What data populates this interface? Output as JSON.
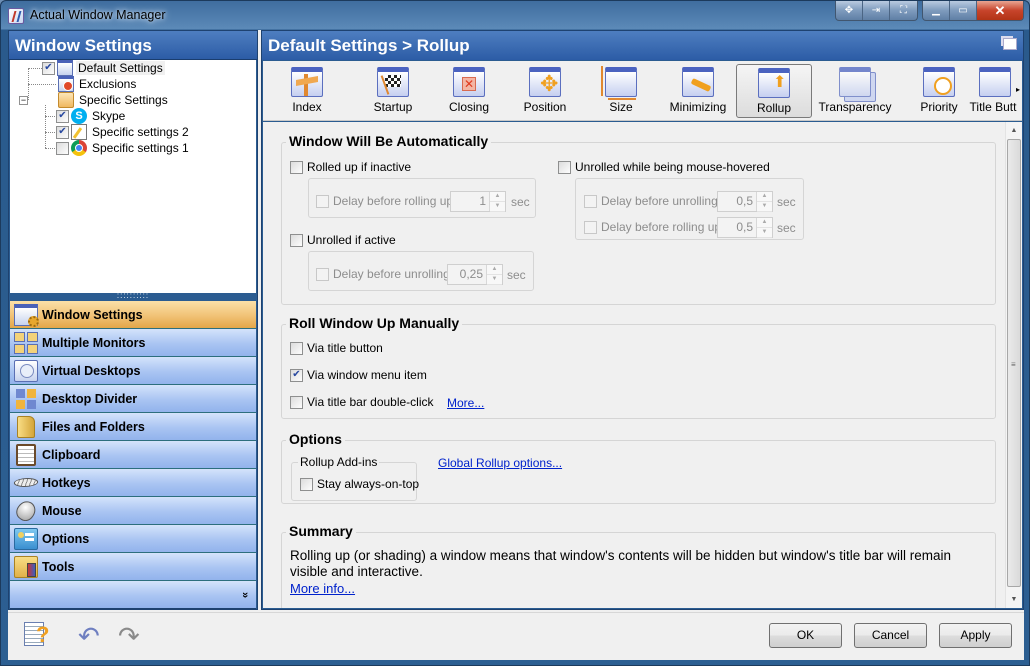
{
  "window": {
    "title": "Actual Window Manager",
    "title_buttons": [
      {
        "name": "move-icon",
        "glyph": "✥"
      },
      {
        "name": "pin-icon",
        "glyph": "⇥"
      },
      {
        "name": "fullscreen-icon",
        "glyph": "⛶"
      },
      {
        "name": "minimize-icon",
        "glyph": "▁"
      },
      {
        "name": "maximize-icon",
        "glyph": "▭"
      },
      {
        "name": "close-icon",
        "glyph": "✕"
      }
    ]
  },
  "left": {
    "header": "Window Settings",
    "tree": [
      {
        "label": "Default Settings",
        "checked": true,
        "icon": "window-icon",
        "selected": true
      },
      {
        "label": "Exclusions",
        "icon": "exclusions-icon"
      },
      {
        "label": "Specific Settings",
        "icon": "folder-icon",
        "expander": "−"
      },
      {
        "label": "Skype",
        "checked": true,
        "icon": "skype-icon"
      },
      {
        "label": "Specific settings 2",
        "checked": true,
        "icon": "notepad-icon"
      },
      {
        "label": "Specific settings 1",
        "checked": false,
        "icon": "chrome-icon"
      }
    ],
    "splitter": "::::::::::",
    "nav": [
      {
        "label": "Window Settings",
        "icon": "window-settings-icon",
        "active": true
      },
      {
        "label": "Multiple Monitors",
        "icon": "monitors-icon"
      },
      {
        "label": "Virtual Desktops",
        "icon": "virtual-desktops-icon"
      },
      {
        "label": "Desktop Divider",
        "icon": "desktop-divider-icon"
      },
      {
        "label": "Files and Folders",
        "icon": "folder-icon"
      },
      {
        "label": "Clipboard",
        "icon": "clipboard-icon"
      },
      {
        "label": "Hotkeys",
        "icon": "keyboard-icon"
      },
      {
        "label": "Mouse",
        "icon": "mouse-icon"
      },
      {
        "label": "Options",
        "icon": "options-icon"
      },
      {
        "label": "Tools",
        "icon": "tools-icon"
      }
    ],
    "nav_more": "»"
  },
  "right": {
    "header": "Default Settings > Rollup",
    "toolbar": [
      {
        "label": "Index",
        "icon": "signpost-icon"
      },
      {
        "label": "Startup",
        "icon": "checkered-flag-icon"
      },
      {
        "label": "Closing",
        "icon": "close-window-icon"
      },
      {
        "label": "Position",
        "icon": "move-arrows-icon"
      },
      {
        "label": "Size",
        "icon": "resize-icon"
      },
      {
        "label": "Minimizing",
        "icon": "minimize-arrow-icon"
      },
      {
        "label": "Rollup",
        "icon": "rollup-icon",
        "active": true
      },
      {
        "label": "Transparency",
        "icon": "transparency-icon"
      },
      {
        "label": "Priority",
        "icon": "clock-icon"
      },
      {
        "label": "Title Butt",
        "icon": "title-buttons-icon"
      }
    ],
    "toolbar_scroll": "▸",
    "auto": {
      "title": "Window Will Be Automatically",
      "rolled_up_inactive": {
        "label": "Rolled up if inactive",
        "checked": false
      },
      "delay_rolling_up": {
        "label": "Delay before rolling up",
        "value": "1",
        "unit": "sec"
      },
      "unrolled_active": {
        "label": "Unrolled if active",
        "checked": false
      },
      "delay_unrolling": {
        "label": "Delay before unrolling",
        "value": "0,25",
        "unit": "sec"
      },
      "unrolled_hover": {
        "label": "Unrolled while being mouse-hovered",
        "checked": false
      },
      "hover_delay_unrolling": {
        "label": "Delay before unrolling",
        "value": "0,5",
        "unit": "sec"
      },
      "hover_delay_rolling": {
        "label": "Delay before rolling up",
        "value": "0,5",
        "unit": "sec"
      }
    },
    "manual": {
      "title": "Roll Window Up Manually",
      "via_title_button": {
        "label": "Via title button",
        "checked": false
      },
      "via_window_menu": {
        "label": "Via window menu item",
        "checked": true
      },
      "via_double_click": {
        "label": "Via title bar double-click",
        "checked": false
      },
      "more_link": "More..."
    },
    "options": {
      "title": "Options",
      "addins_title": "Rollup Add-ins",
      "stay_on_top": {
        "label": "Stay always-on-top",
        "checked": false
      },
      "global_link": "Global Rollup options..."
    },
    "summary": {
      "title": "Summary",
      "text": "Rolling up (or shading) a window means that window's contents will be hidden but window's title bar will remain visible and interactive.",
      "more_info": "More info..."
    }
  },
  "footer": {
    "ok": "OK",
    "cancel": "Cancel",
    "apply": "Apply"
  }
}
